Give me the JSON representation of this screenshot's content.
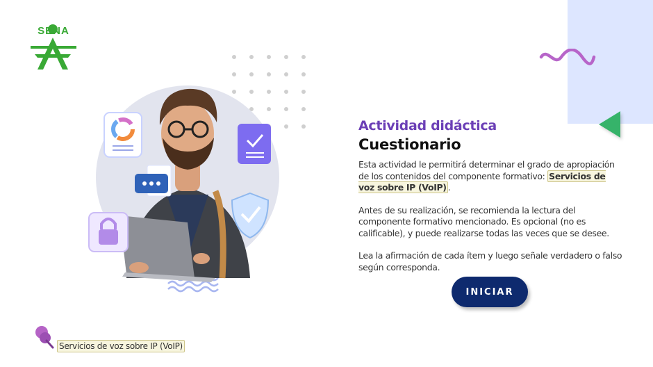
{
  "logo": {
    "text": "SENA"
  },
  "content": {
    "eyebrow": "Actividad didáctica",
    "title": "Cuestionario",
    "p1_text": "Esta actividad le permitirá determinar el grado de apropiación de los contenidos del componente formativo: ",
    "p1_highlight": "Servicios de voz sobre IP (VoIP)",
    "p1_end": ".",
    "p2": "Antes de su realización, se recomienda la lectura del componente formativo mencionado.  Es opcional (no es calificable), y puede realizarse todas las veces que se desee.",
    "p3": "Lea la afirmación de cada ítem y luego señale verdadero o falso según corresponda."
  },
  "button": {
    "label": "INICIAR"
  },
  "footer": {
    "tag": "Servicios de voz sobre  IP (VoIP)"
  },
  "colors": {
    "accent_purple": "#6b3fb6",
    "button_navy": "#0e2a6e",
    "sena_green": "#39a935",
    "deco_blue": "#dde6ff",
    "triangle_green": "#36b36a"
  }
}
